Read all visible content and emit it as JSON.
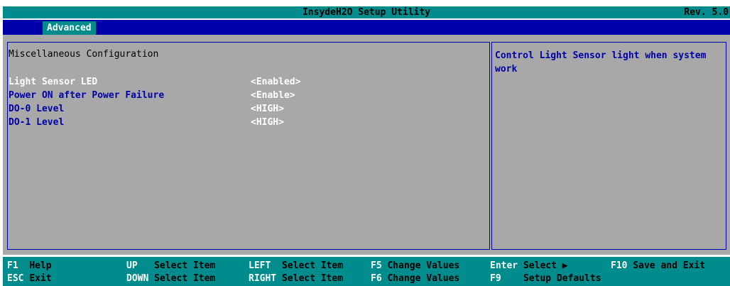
{
  "header": {
    "title": "InsydeH2O Setup Utility",
    "revision": "Rev. 5.0"
  },
  "tabs": [
    {
      "label": "Advanced",
      "active": true
    }
  ],
  "main": {
    "section_title": "Miscellaneous Configuration",
    "items": [
      {
        "label": "Light Sensor LED",
        "value": "<Enabled>",
        "selected": true
      },
      {
        "label": "Power ON after Power Failure",
        "value": "<Enable>"
      },
      {
        "label": "DO-0 Level",
        "value": "<HIGH>"
      },
      {
        "label": "DO-1 Level",
        "value": "<HIGH>"
      }
    ]
  },
  "help": {
    "text": "Control Light Sensor light when system work"
  },
  "footer": {
    "keys": [
      {
        "key": "F1",
        "desc": "Help"
      },
      {
        "key": "ESC",
        "desc": "Exit"
      },
      {
        "key": "UP",
        "desc": "Select Item"
      },
      {
        "key": "DOWN",
        "desc": "Select Item"
      },
      {
        "key": "LEFT",
        "desc": "Select Item"
      },
      {
        "key": "RIGHT",
        "desc": "Select Item"
      },
      {
        "key": "F5",
        "desc": "Change Values"
      },
      {
        "key": "F6",
        "desc": "Change Values"
      },
      {
        "key": "Enter",
        "desc": "Select ▶"
      },
      {
        "key": "F9",
        "desc": "Setup Defaults"
      },
      {
        "key": "F10",
        "desc": "Save and Exit"
      }
    ]
  },
  "colors": {
    "title_bar": "#008c8c",
    "tab_bar": "#0000a8",
    "panel_bg": "#a8a8a8",
    "item_label": "#0000a8",
    "highlight": "#ffffff"
  }
}
